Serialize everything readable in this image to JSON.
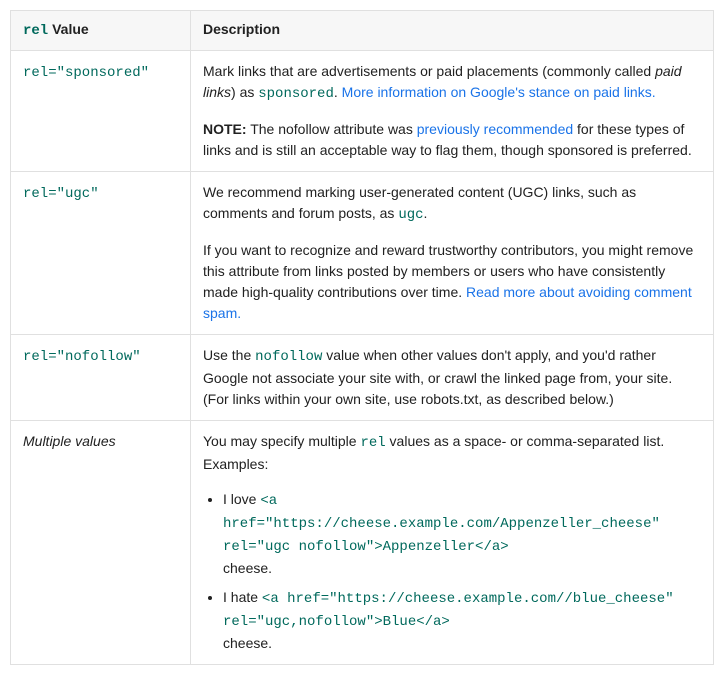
{
  "headers": {
    "rel": "rel",
    "value": " Value",
    "desc": "Description"
  },
  "rows": {
    "sponsored": {
      "rel": "rel=\"sponsored\"",
      "p1a": "Mark links that are advertisements or paid placements (commonly called ",
      "p1_italic": "paid links",
      "p1b": ") as ",
      "p1_code": "sponsored",
      "p1c": ". ",
      "p1_link": "More information on Google's stance on paid links.",
      "p2_bold": "NOTE:",
      "p2a": " The nofollow attribute was ",
      "p2_link": "previously recommended",
      "p2b": " for these types of links and is still an acceptable way to flag them, though sponsored is preferred."
    },
    "ugc": {
      "rel": "rel=\"ugc\"",
      "p1a": "We recommend marking user-generated content (UGC) links, such as comments and forum posts, as ",
      "p1_code": "ugc",
      "p1b": ".",
      "p2a": "If you want to recognize and reward trustworthy contributors, you might remove this attribute from links posted by members or users who have consistently made high-quality contributions over time. ",
      "p2_link": "Read more about avoiding comment spam."
    },
    "nofollow": {
      "rel": "rel=\"nofollow\"",
      "p1a": "Use the ",
      "p1_code": "nofollow",
      "p1b": " value when other values don't apply, and you'd rather Google not associate your site with, or crawl the linked page from, your site. (For links within your own site, use robots.txt, as described below.)"
    },
    "multi": {
      "label": "Multiple values",
      "p1a": "You may specify multiple ",
      "p1_code": "rel",
      "p1b": " values as a space- or comma-separated list. Examples:",
      "li1a": "I love ",
      "li1_code1": "<a href=\"https://cheese.example.com/Appenzeller_cheese\"",
      "li1_code2": "rel=\"ugc nofollow\">Appenzeller</a>",
      "li1b": " cheese.",
      "li2a": "I hate ",
      "li2_code1": "<a href=\"https://cheese.example.com//blue_cheese\"",
      "li2_code2": "rel=\"ugc,nofollow\">Blue</a>",
      "li2b": " cheese."
    }
  }
}
